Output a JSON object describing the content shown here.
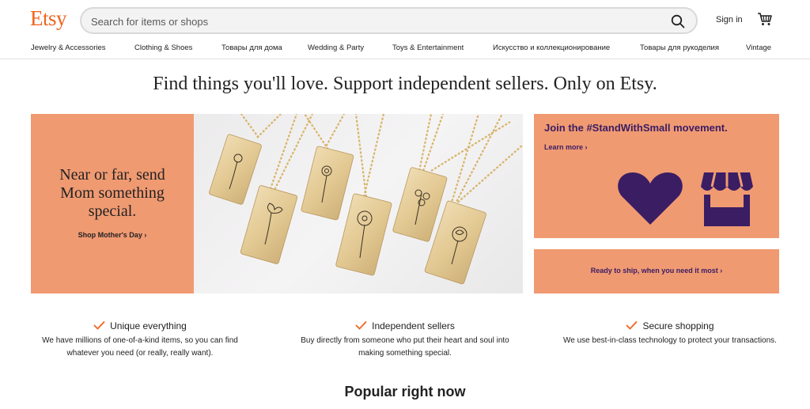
{
  "header": {
    "logo": "Etsy",
    "search_placeholder": "Search for items or shops",
    "signin": "Sign in"
  },
  "nav": {
    "items": [
      "Jewelry & Accessories",
      "Clothing & Shoes",
      "Товары для дома",
      "Wedding & Party",
      "Toys & Entertainment",
      "Искусство и коллекционирование",
      "Товары для рукоделия",
      "Vintage"
    ]
  },
  "headline": "Find things you'll love. Support independent sellers. Only on Etsy.",
  "hero": {
    "text": "Near or far, send Mom something special.",
    "link": "Shop Mother's Day ›"
  },
  "promo1": {
    "title": "Join the #StandWithSmall movement.",
    "link": "Learn more ›"
  },
  "promo2": {
    "link": "Ready to ship, when you need it most ›"
  },
  "features": [
    {
      "title": "Unique everything",
      "text": "We have millions of one-of-a-kind items, so you can find whatever you need (or really, really want)."
    },
    {
      "title": "Independent sellers",
      "text": "Buy directly from someone who put their heart and soul into making something special."
    },
    {
      "title": "Secure shopping",
      "text": "We use best-in-class technology to protect your transactions."
    }
  ],
  "popular_title": "Popular right now",
  "colors": {
    "brand": "#F1641E",
    "promo_bg": "#F09A72",
    "promo_accent": "#3A1D63"
  }
}
